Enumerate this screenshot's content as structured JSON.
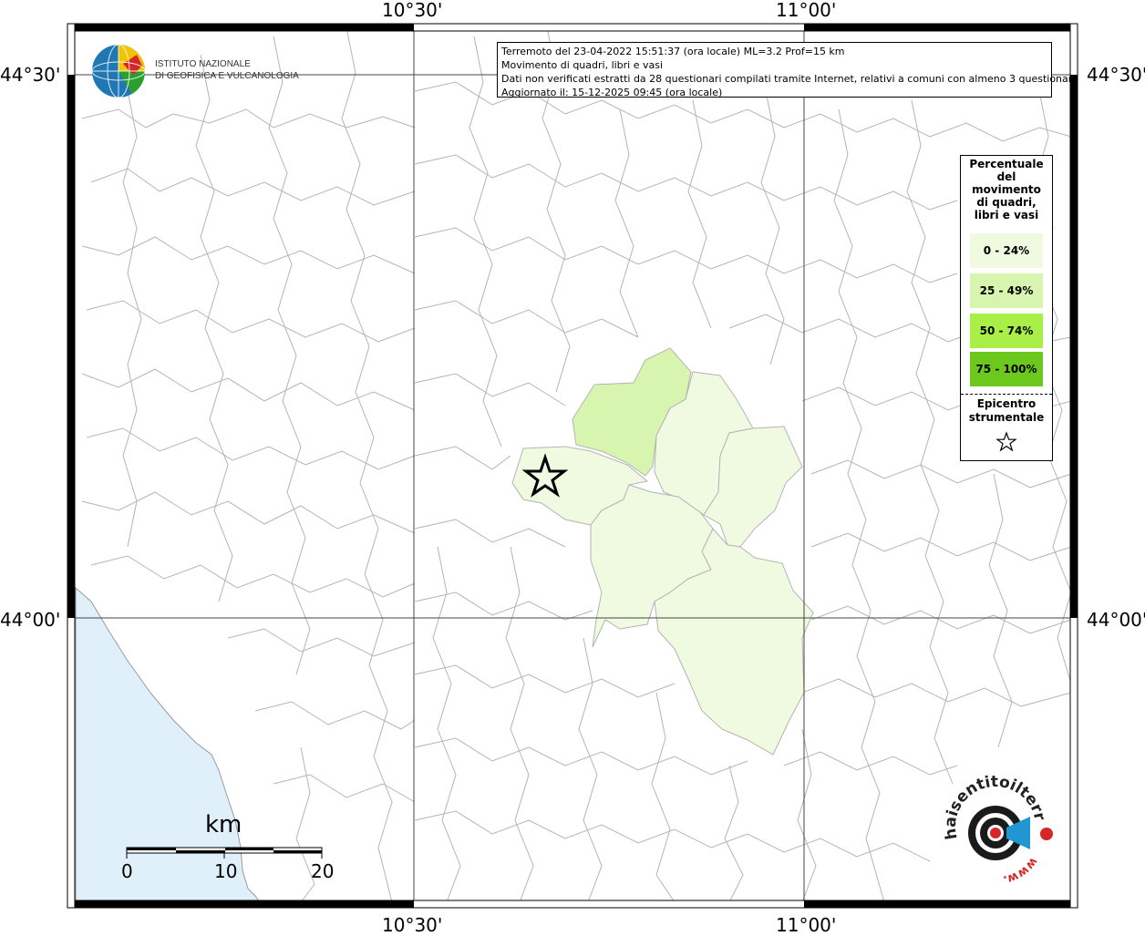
{
  "axes": {
    "top_labels": [
      "10°30'",
      "11°00'"
    ],
    "bottom_labels": [
      "10°30'",
      "11°00'"
    ],
    "left_labels": [
      "44°30'",
      "44°00'"
    ],
    "right_labels": [
      "44°30'",
      "44°00'"
    ]
  },
  "info": {
    "line1": "Terremoto del 23-04-2022 15:51:37 (ora locale) ML=3.2 Prof=15 km",
    "line2": "Movimento di quadri, libri e vasi",
    "line3": "Dati non verificati estratti da 28 questionari compilati tramite Internet, relativi a comuni con almeno 3 questionari.",
    "line4": "Aggiornato il: 15-12-2025 09:45 (ora locale)"
  },
  "logo": {
    "line1": "ISTITUTO NAZIONALE",
    "line2": "DI GEOFISICA E VULCANOLOGIA"
  },
  "legend": {
    "title_lines": [
      "Percentuale",
      "del",
      "movimento",
      "di quadri,",
      "libri e vasi"
    ],
    "items": [
      {
        "label": "0 - 24%",
        "color": "#f0fae0"
      },
      {
        "label": "25 - 49%",
        "color": "#d8f5b0"
      },
      {
        "label": "50 - 74%",
        "color": "#a8f048"
      },
      {
        "label": "75 - 100%",
        "color": "#6cc81c"
      }
    ],
    "epicenter_lines": [
      "Epicentro",
      "strumentale"
    ]
  },
  "scale": {
    "unit": "km",
    "ticks": [
      "0",
      "10",
      "20"
    ]
  },
  "colors": {
    "sea": "#dff0fb",
    "class_0_24": "#f0fae0",
    "class_25_49": "#d8f5b0",
    "boundary": "#b4b4b4",
    "grid": "#444444"
  },
  "footer_logo": {
    "text": "haisentitoilterremoto.it",
    "url_text": "www."
  }
}
